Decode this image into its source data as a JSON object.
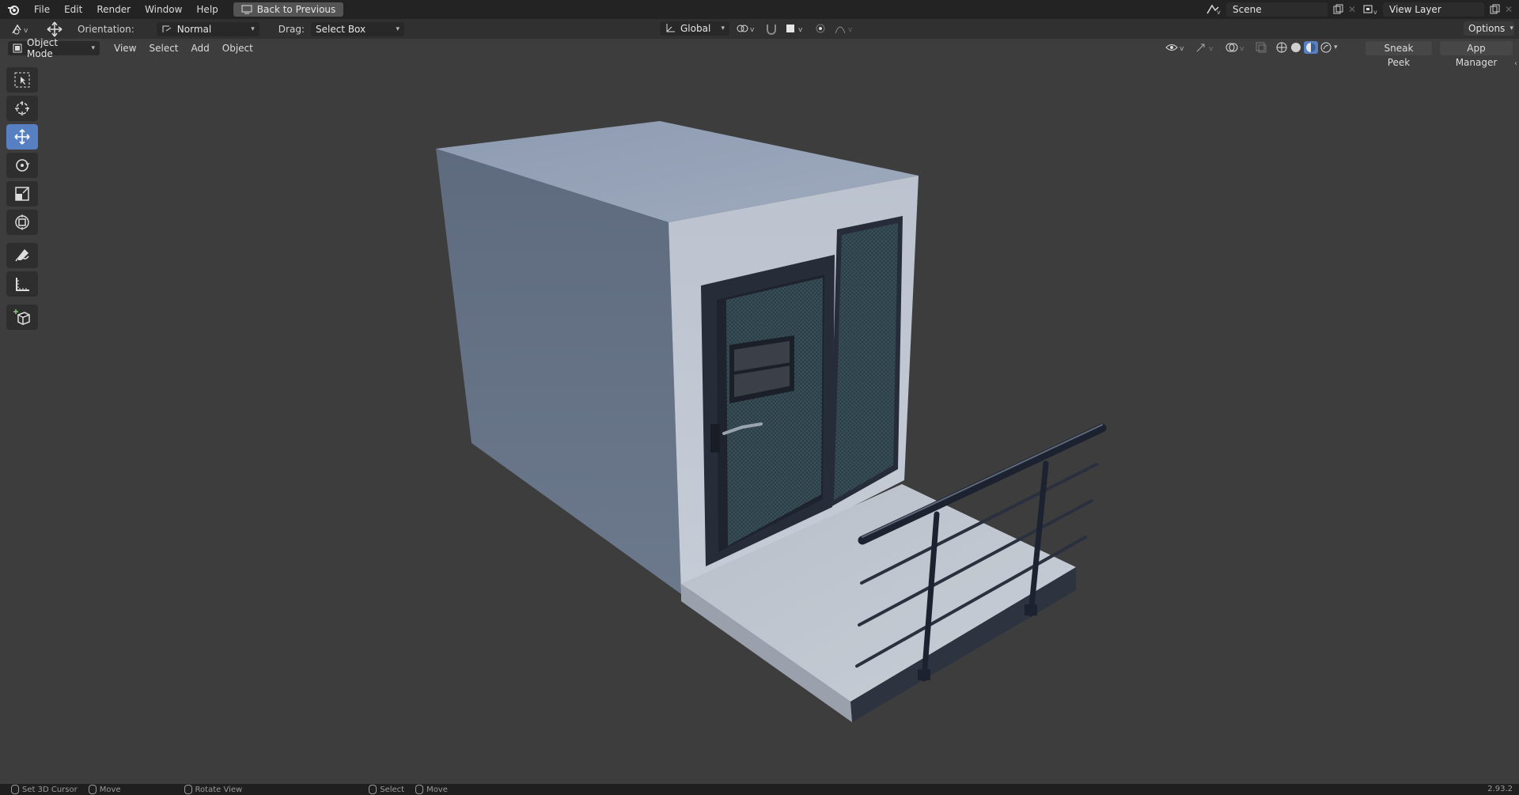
{
  "topbar": {
    "menu": [
      "File",
      "Edit",
      "Render",
      "Window",
      "Help"
    ],
    "back_button": "Back to Previous",
    "scene": "Scene",
    "view_layer": "View Layer"
  },
  "header": {
    "orientation_label": "Orientation:",
    "orientation_value": "Normal",
    "drag_label": "Drag:",
    "drag_value": "Select Box",
    "transform_orientation": "Global",
    "options": "Options"
  },
  "viewheader": {
    "mode": "Object Mode",
    "menus": [
      "View",
      "Select",
      "Add",
      "Object"
    ],
    "sneak_peek": "Sneak Peek",
    "app_manager": "App Manager"
  },
  "toolbar": {
    "tools": [
      "select-box-tool",
      "cursor-tool",
      "move-tool",
      "rotate-tool",
      "scale-tool",
      "transform-tool",
      "annotate-tool",
      "measure-tool",
      "add-cube-tool"
    ],
    "active": "move-tool"
  },
  "statusbar": {
    "items": [
      "Set 3D Cursor",
      "Move",
      "Rotate View",
      "Select",
      "Move"
    ],
    "version": "2.93.2"
  },
  "colors": {
    "accent": "#5680c2",
    "background": "#3d3d3d",
    "topbar": "#232323"
  }
}
